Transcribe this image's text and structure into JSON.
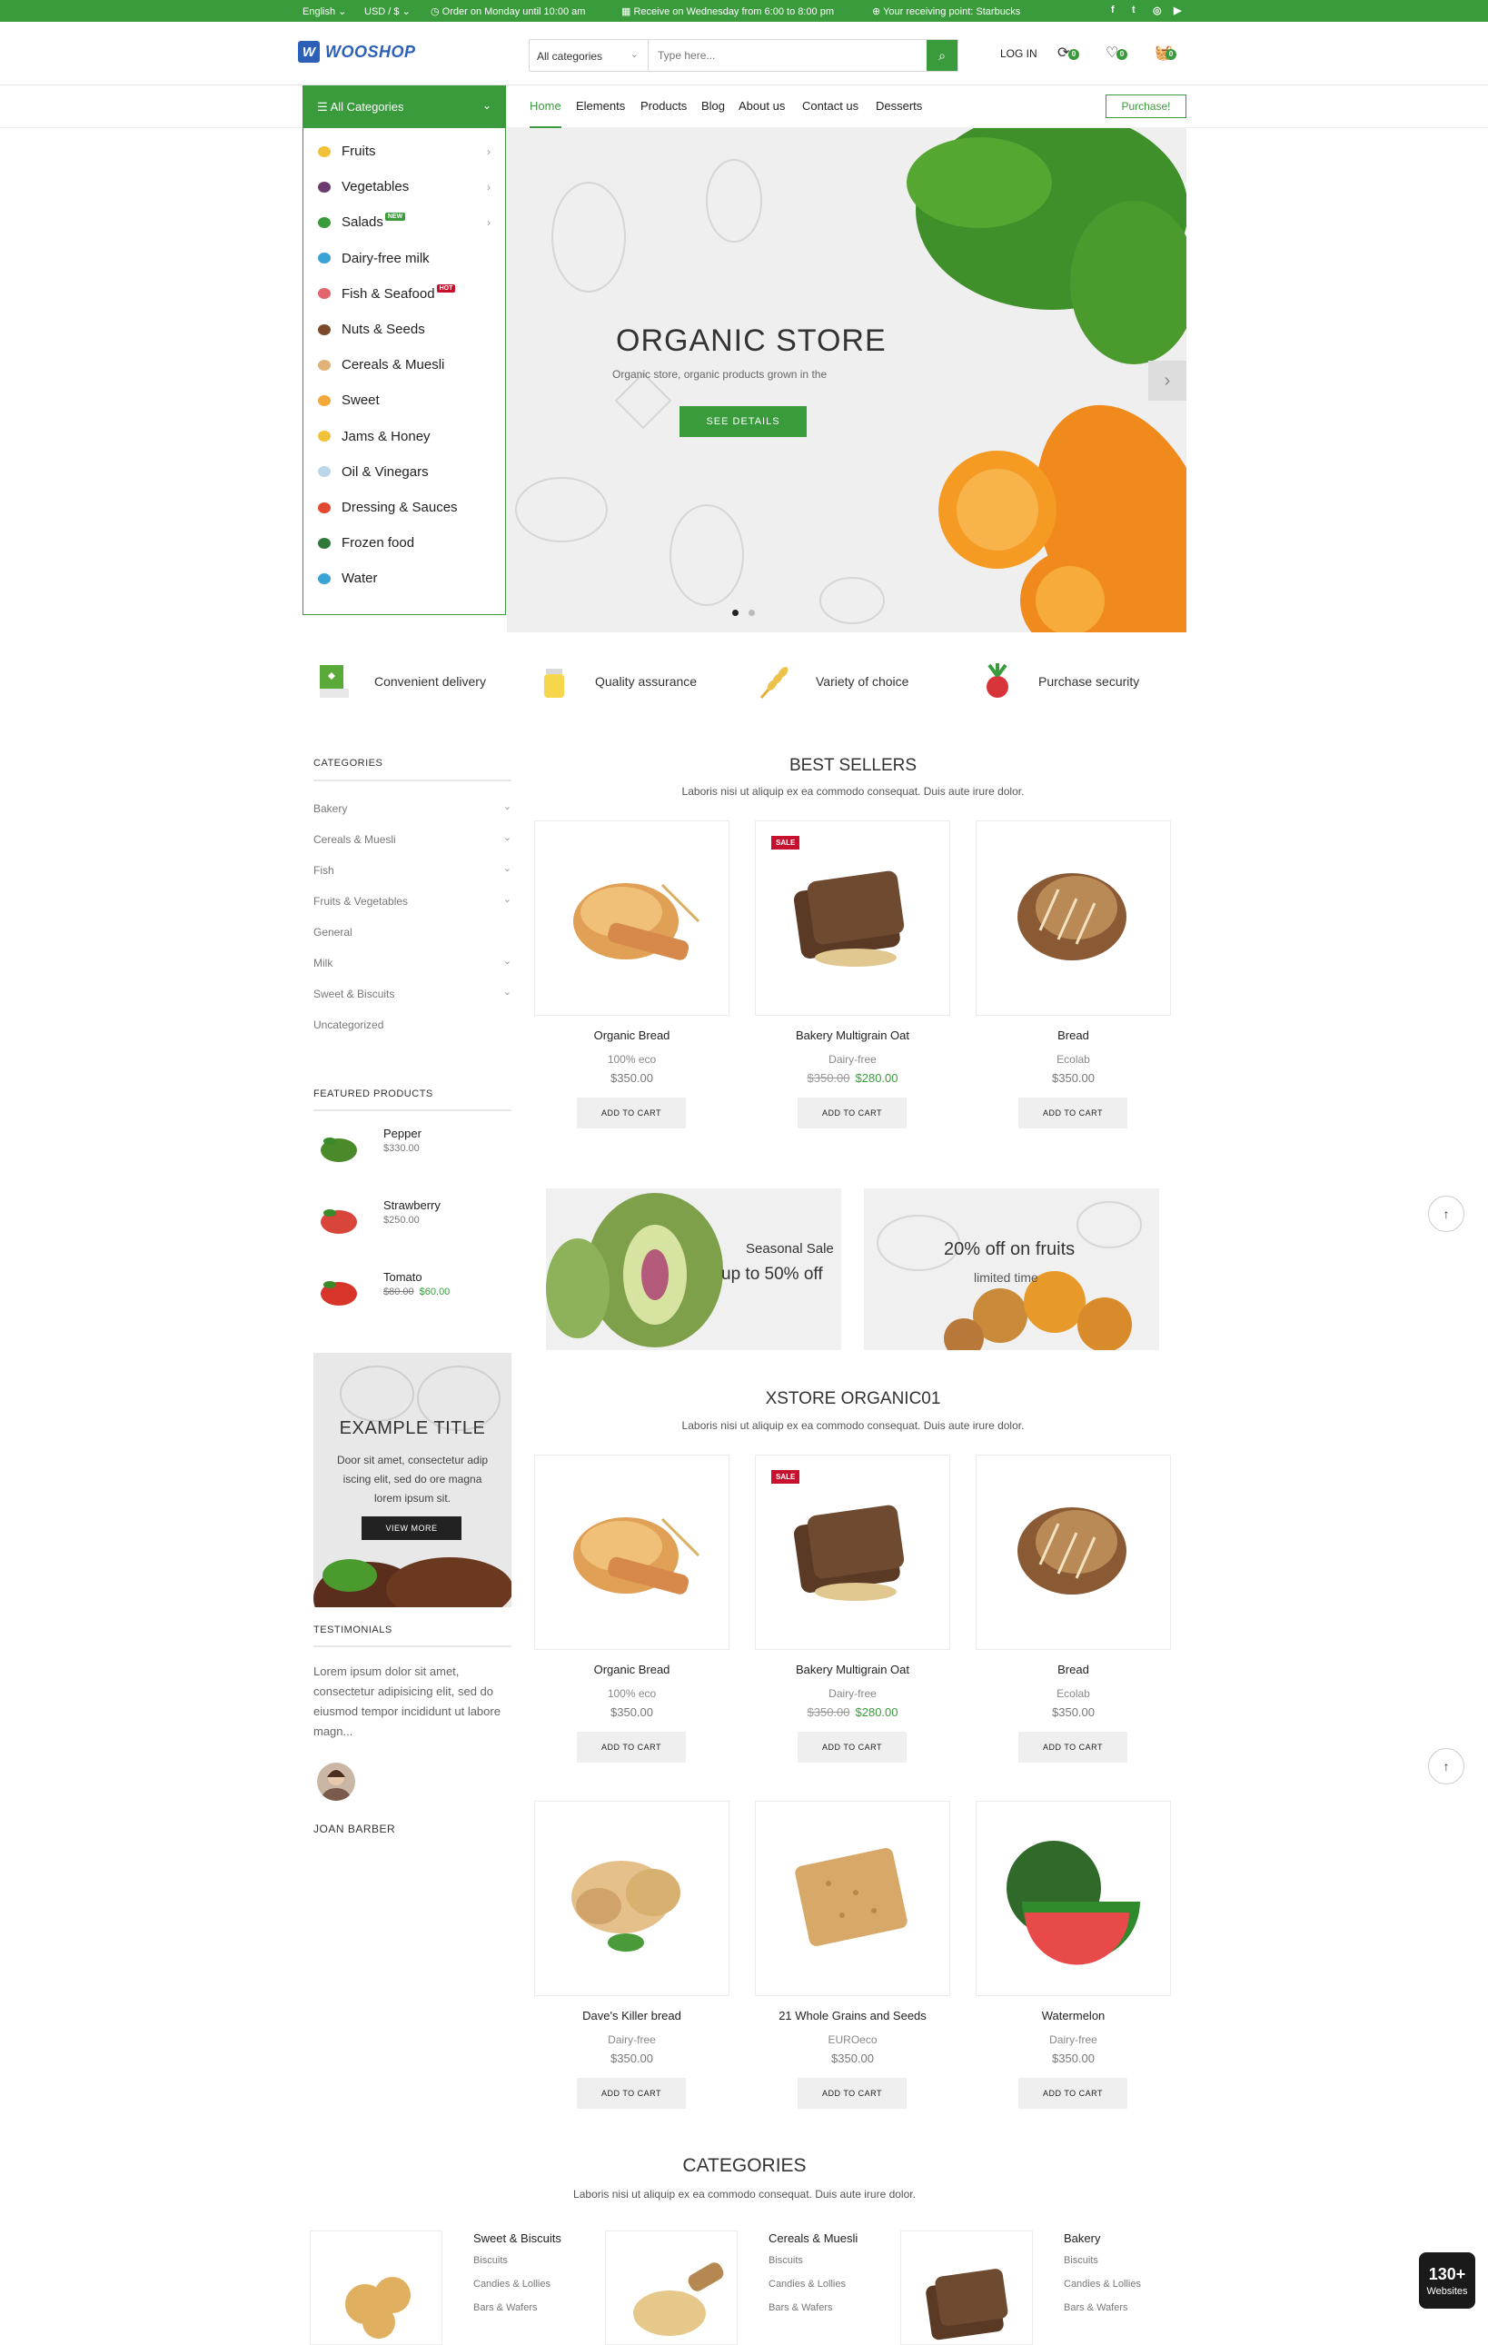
{
  "topbar": {
    "language": "English",
    "currency": "USD / $",
    "order_info": "Order on Monday until 10:00 am",
    "receive_info": "Receive on Wednesday from 6:00 to 8:00 pm",
    "receiving_point": "Your receiving point: Starbucks",
    "social_icons": [
      "facebook-icon",
      "twitter-icon",
      "instagram-icon",
      "youtube-icon"
    ]
  },
  "header": {
    "logo_text": "WOOSHOP",
    "logo_mark": "W",
    "search_category": "All categories",
    "search_placeholder": "Type here...",
    "login_label": "LOG IN",
    "compare_count": "0",
    "wishlist_count": "0",
    "cart_count": "0"
  },
  "nav": {
    "all_categories_label": "All Categories",
    "links": [
      "Home",
      "Elements",
      "Products",
      "Blog",
      "About us",
      "Contact us",
      "Desserts"
    ],
    "active": "Home",
    "purchase_label": "Purchase!"
  },
  "category_menu": [
    {
      "label": "Fruits",
      "has_arrow": true,
      "color": "#f2c13a"
    },
    {
      "label": "Vegetables",
      "has_arrow": true,
      "color": "#6b3a6e"
    },
    {
      "label": "Salads",
      "has_arrow": true,
      "tag": "NEW",
      "tag_color": "#3a9b3c",
      "color": "#3a9b3c"
    },
    {
      "label": "Dairy-free milk",
      "color": "#3aa3d6"
    },
    {
      "label": "Fish & Seafood",
      "tag": "HOT",
      "tag_color": "#c8102e",
      "color": "#e2646c"
    },
    {
      "label": "Nuts & Seeds",
      "color": "#7a4a2a"
    },
    {
      "label": "Cereals & Muesli",
      "color": "#e0b278"
    },
    {
      "label": "Sweet",
      "color": "#f2a93a"
    },
    {
      "label": "Jams & Honey",
      "color": "#f2c13a"
    },
    {
      "label": "Oil & Vinegars",
      "color": "#b9d7e8"
    },
    {
      "label": "Dressing & Sauces",
      "color": "#e2472f"
    },
    {
      "label": "Frozen food",
      "color": "#2f7a3a"
    },
    {
      "label": "Water",
      "color": "#3aa3d6"
    }
  ],
  "hero": {
    "title": "ORGANIC STORE",
    "subtitle": "Organic store, organic products grown in the",
    "button": "SEE DETAILS",
    "active_slide": 1,
    "slides": 2
  },
  "features": [
    {
      "label": "Convenient delivery",
      "icon": "delivery-box-icon"
    },
    {
      "label": "Quality assurance",
      "icon": "juice-jar-icon"
    },
    {
      "label": "Variety of choice",
      "icon": "wheat-icon"
    },
    {
      "label": "Purchase security",
      "icon": "radish-icon"
    }
  ],
  "sidebar": {
    "categories_title": "CATEGORIES",
    "categories": [
      {
        "label": "Bakery",
        "expandable": true
      },
      {
        "label": "Cereals & Muesli",
        "expandable": true
      },
      {
        "label": "Fish",
        "expandable": true
      },
      {
        "label": "Fruits & Vegetables",
        "expandable": true
      },
      {
        "label": "General",
        "expandable": false
      },
      {
        "label": "Milk",
        "expandable": true
      },
      {
        "label": "Sweet & Biscuits",
        "expandable": true
      },
      {
        "label": "Uncategorized",
        "expandable": false
      }
    ],
    "featured_title": "FEATURED PRODUCTS",
    "featured": [
      {
        "name": "Pepper",
        "price": "$330.00",
        "color": "#4b8a2a"
      },
      {
        "name": "Strawberry",
        "price": "$250.00",
        "color": "#d8453a"
      },
      {
        "name": "Tomato",
        "old_price": "$80.00",
        "price": "$60.00",
        "color": "#d8352a"
      }
    ],
    "promo": {
      "title": "EXAMPLE TITLE",
      "text": "Door sit amet, consectetur adip iscing elit, sed do ore magna lorem ipsum sit.",
      "button": "VIEW MORE"
    },
    "testimonials_title": "TESTIMONIALS",
    "testimonial_text": "Lorem ipsum dolor sit amet, consectetur adipisicing elit, sed do eiusmod tempor incididunt ut labore magn...",
    "testimonial_name": "JOAN BARBER"
  },
  "best_sellers": {
    "title": "BEST SELLERS",
    "subtitle": "Laboris nisi ut aliquip ex ea commodo consequat. Duis aute irure dolor.",
    "products": [
      {
        "name": "Organic Bread",
        "brand": "100% eco",
        "price": "$350.00",
        "sale": false,
        "button": "ADD TO CART"
      },
      {
        "name": "Bakery Multigrain Oat",
        "brand": "Dairy-free",
        "old_price": "$350.00",
        "price": "$280.00",
        "sale": true,
        "button": "ADD TO CART"
      },
      {
        "name": "Bread",
        "brand": "Ecolab",
        "price": "$350.00",
        "sale": false,
        "button": "ADD TO CART"
      }
    ],
    "sale_label": "SALE"
  },
  "banners": [
    {
      "line1": "Seasonal Sale",
      "line2": "up to 50% off"
    },
    {
      "line1": "20% off on fruits",
      "line2": "limited time"
    }
  ],
  "xstore": {
    "title": "XSTORE ORGANIC01",
    "subtitle": "Laboris nisi ut aliquip ex ea commodo consequat. Duis aute irure dolor.",
    "products": [
      {
        "name": "Organic Bread",
        "brand": "100% eco",
        "price": "$350.00",
        "sale": false,
        "button": "ADD TO CART"
      },
      {
        "name": "Bakery Multigrain Oat",
        "brand": "Dairy-free",
        "old_price": "$350.00",
        "price": "$280.00",
        "sale": true,
        "button": "ADD TO CART"
      },
      {
        "name": "Bread",
        "brand": "Ecolab",
        "price": "$350.00",
        "sale": false,
        "button": "ADD TO CART"
      },
      {
        "name": "Dave's Killer bread",
        "brand": "Dairy-free",
        "price": "$350.00",
        "sale": false,
        "button": "ADD TO CART"
      },
      {
        "name": "21 Whole Grains and Seeds",
        "brand": "EUROeco",
        "price": "$350.00",
        "sale": false,
        "button": "ADD TO CART"
      },
      {
        "name": "Watermelon",
        "brand": "Dairy-free",
        "price": "$350.00",
        "sale": false,
        "button": "ADD TO CART"
      }
    ]
  },
  "categories_section": {
    "title": "CATEGORIES",
    "subtitle": "Laboris nisi ut aliquip ex ea commodo consequat. Duis aute irure dolor.",
    "items": [
      {
        "title": "Sweet & Biscuits",
        "subs": [
          "Biscuits",
          "Candies & Lollies",
          "Bars & Wafers"
        ]
      },
      {
        "title": "Cereals & Muesli",
        "subs": [
          "Biscuits",
          "Candies & Lollies",
          "Bars & Wafers"
        ]
      },
      {
        "title": "Bakery",
        "subs": [
          "Biscuits",
          "Candies & Lollies",
          "Bars & Wafers"
        ]
      }
    ]
  },
  "websites_badge": {
    "count": "130+",
    "label": "Websites"
  },
  "colors": {
    "brand_green": "#3a9b3c",
    "sale_red": "#c8102e",
    "logo_blue": "#2b5fb8"
  }
}
